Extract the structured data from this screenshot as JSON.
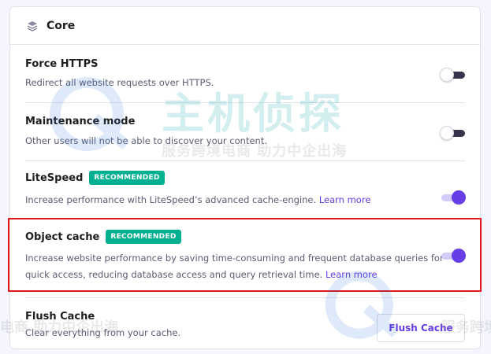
{
  "section": {
    "title": "Core",
    "icon": "layers-icon"
  },
  "settings": [
    {
      "name": "Force HTTPS",
      "description": "Redirect all website requests over HTTPS.",
      "enabled": false
    },
    {
      "name": "Maintenance mode",
      "description": "Other users will not be able to discover your content.",
      "enabled": false
    },
    {
      "name": "LiteSpeed",
      "badge": "RECOMMENDED",
      "description": "Increase performance with LiteSpeed’s advanced cache-engine.",
      "link": "Learn more",
      "enabled": true
    },
    {
      "name": "Object cache",
      "badge": "RECOMMENDED",
      "description_line1": "Increase website performance by saving time-consuming and frequent database queries for",
      "description_line2": "quick access, reducing database access and query retrieval time.",
      "link": "Learn more",
      "enabled": true
    },
    {
      "name": "Flush Cache",
      "description": "Clear everything from your cache.",
      "button": "Flush Cache"
    }
  ],
  "watermark": {
    "big_text": "主机侦探",
    "small_text": "服务跨境电商 助力中企出海",
    "left_fragment": "电商 助力中企出海",
    "right_fragment": "服务跨境"
  },
  "colors": {
    "accent": "#673de6",
    "badge": "#00b090",
    "highlight": "#e0161b",
    "watermark": "#14a6a6"
  }
}
